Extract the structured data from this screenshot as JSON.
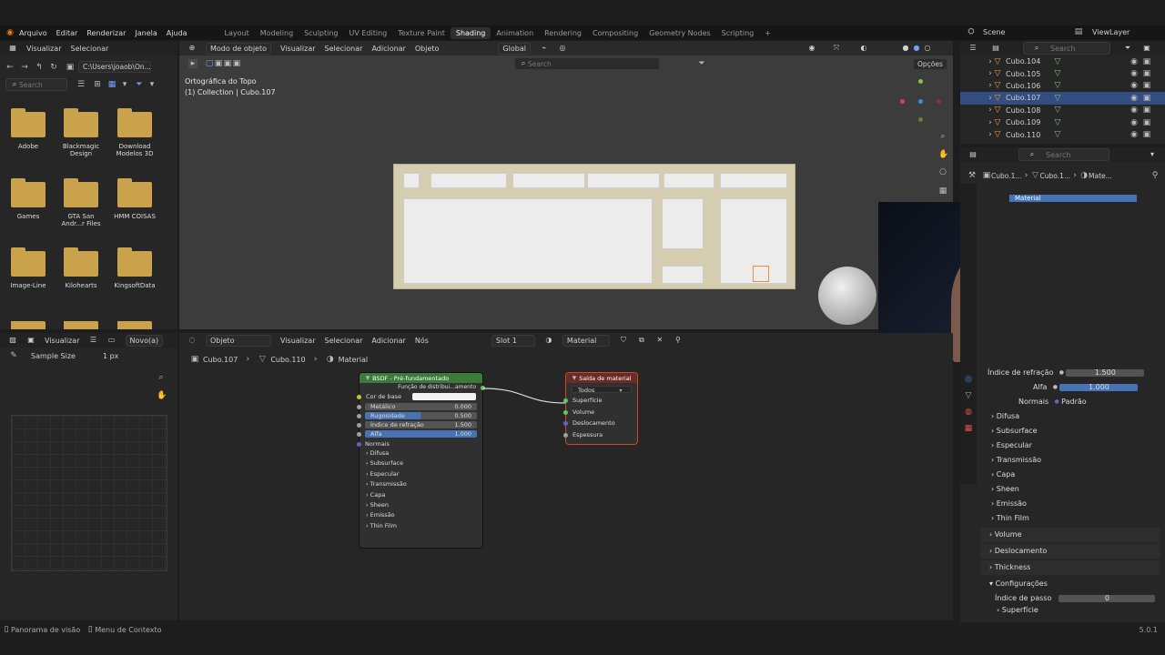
{
  "menu": [
    "Arquivo",
    "Editar",
    "Renderizar",
    "Janela",
    "Ajuda"
  ],
  "workspaces": [
    {
      "label": "Layout",
      "active": false
    },
    {
      "label": "Modeling",
      "active": false
    },
    {
      "label": "Sculpting",
      "active": false
    },
    {
      "label": "UV Editing",
      "active": false
    },
    {
      "label": "Texture Paint",
      "active": false
    },
    {
      "label": "Shading",
      "active": true
    },
    {
      "label": "Animation",
      "active": false
    },
    {
      "label": "Rendering",
      "active": false
    },
    {
      "label": "Compositing",
      "active": false
    },
    {
      "label": "Geometry Nodes",
      "active": false
    },
    {
      "label": "Scripting",
      "active": false
    }
  ],
  "scene": {
    "label": "Scene",
    "viewlayer": "ViewLayer"
  },
  "filebrowser": {
    "header": [
      "Visualizar",
      "Selecionar"
    ],
    "path": "C:\\Users\\joaob\\On...",
    "search_placeholder": "Search",
    "folders": [
      "Adobe",
      "Blackmagic Design",
      "Download Modelos 3D",
      "Games",
      "GTA San Andr...r Files",
      "HMM COISAS",
      "Image-Line",
      "Kilohearts",
      "KingsoftData"
    ]
  },
  "imageeditor": {
    "header": [
      "Visualizar",
      "Novo(a)"
    ],
    "sample_label": "Sample Size",
    "sample_value": "1 px"
  },
  "viewport": {
    "mode": "Modo de objeto",
    "menus": [
      "Visualizar",
      "Selecionar",
      "Adicionar",
      "Objeto"
    ],
    "transform": "Global",
    "options": "Opções",
    "search": "Search",
    "view_title": "Ortográfica do Topo",
    "collection": "(1) Collection | Cubo.107"
  },
  "outliner": {
    "search": "Search",
    "items": [
      {
        "name": "Cubo.104",
        "selected": false
      },
      {
        "name": "Cubo.105",
        "selected": false
      },
      {
        "name": "Cubo.106",
        "selected": false
      },
      {
        "name": "Cubo.107",
        "selected": true
      },
      {
        "name": "Cubo.108",
        "selected": false
      },
      {
        "name": "Cubo.109",
        "selected": false
      },
      {
        "name": "Cubo.110",
        "selected": false
      }
    ]
  },
  "nodeeditor": {
    "type": "Objeto",
    "menus": [
      "Visualizar",
      "Selecionar",
      "Adicionar",
      "Nós"
    ],
    "slot": "Slot 1",
    "material": "Material",
    "breadcrumb": [
      "Cubo.107",
      "Cubo.110",
      "Material"
    ],
    "bsdf": {
      "title": "BSDF - Pré-fundamentado",
      "distribution": "Função de distribui...amento bidirecional",
      "base_color": "Cor de base",
      "fields": [
        {
          "label": "Metálico",
          "value": "0.000",
          "fill": 0
        },
        {
          "label": "Rugosidade",
          "value": "0.500",
          "fill": 0.5
        },
        {
          "label": "Índice de refração",
          "value": "1.500",
          "fill": 0
        },
        {
          "label": "Alfa",
          "value": "1.000",
          "fill": 1
        }
      ],
      "normals": "Normais",
      "panels": [
        "Difusa",
        "Subsurface",
        "Especular",
        "Transmissão",
        "Capa",
        "Sheen",
        "Emissão",
        "Thin Film"
      ]
    },
    "output": {
      "title": "Saída de material",
      "target": "Todos",
      "inputs": [
        "Superfície",
        "Volume",
        "Deslocamento",
        "Espessura"
      ]
    }
  },
  "properties": {
    "search": "Search",
    "breadcrumb": [
      "Cubo.1...",
      "Cubo.1...",
      "Mate..."
    ],
    "material_slot": "Material",
    "ior_label": "Índice de refração",
    "ior_value": "1.500",
    "alpha_label": "Alfa",
    "alpha_value": "1.000",
    "normals_label": "Normais",
    "normals_value": "Padrão",
    "subpanels": [
      "Difusa",
      "Subsurface",
      "Especular",
      "Transmissão",
      "Capa",
      "Sheen",
      "Emissão",
      "Thin Film"
    ],
    "panels": [
      "Volume",
      "Deslocamento",
      "Thickness"
    ],
    "settings": "Configurações",
    "pass_label": "Índice de passo",
    "pass_value": "0",
    "surface": "Superfície"
  },
  "status": {
    "left1": "Panorama de visão",
    "left2": "Menu de Contexto",
    "version": "5.0.1"
  }
}
